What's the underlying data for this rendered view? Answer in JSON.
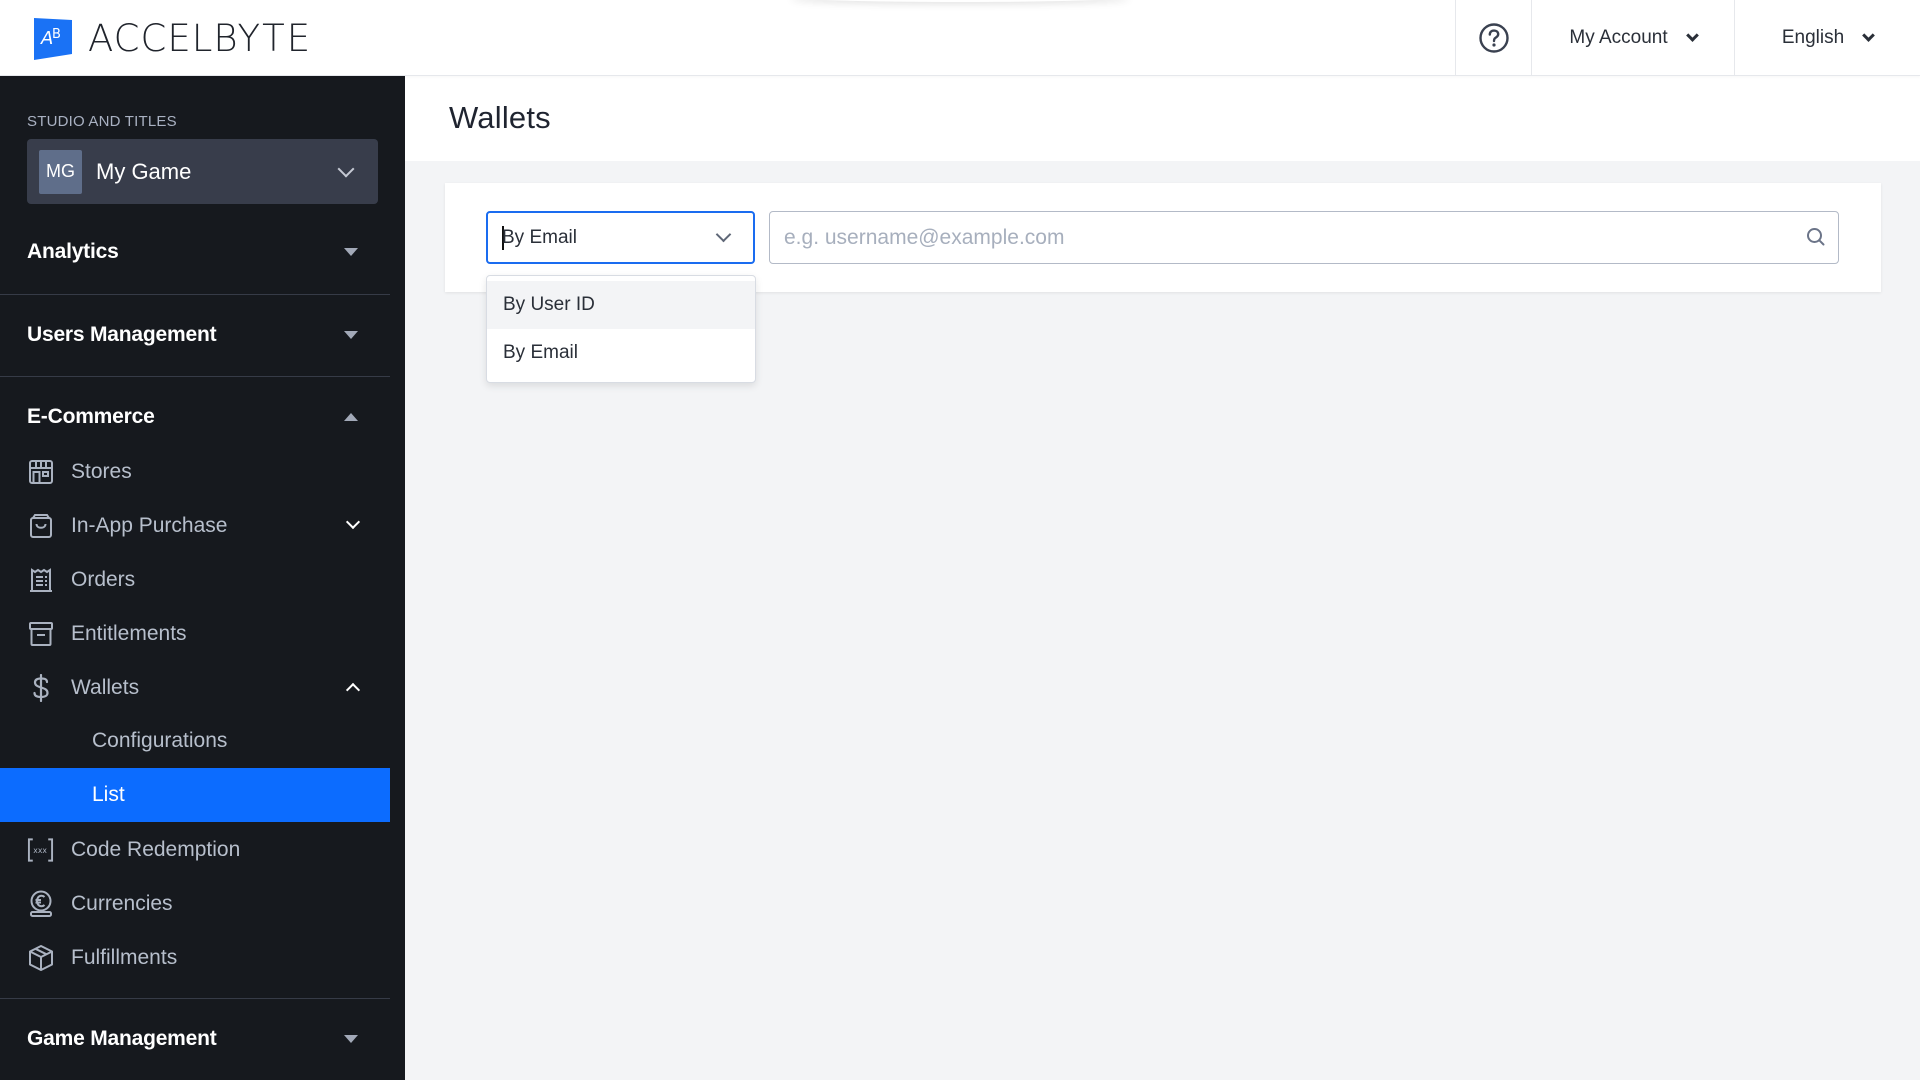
{
  "app": {
    "brand": "ACCELBYTE",
    "brand_part1": "ACCEL",
    "brand_part2": "BYTE",
    "logo_glyph": "AB"
  },
  "header": {
    "help_icon": "question-circle-icon",
    "account_label": "My Account",
    "language_label": "English"
  },
  "sidebar": {
    "studio_label": "STUDIO AND TITLES",
    "title_selector": {
      "initials": "MG",
      "name": "My Game"
    },
    "sections": {
      "analytics": "Analytics",
      "users_management": "Users Management",
      "ecommerce": "E-Commerce",
      "game_management": "Game Management"
    },
    "ecommerce_items": {
      "stores": "Stores",
      "in_app_purchase": "In-App Purchase",
      "orders": "Orders",
      "entitlements": "Entitlements",
      "wallets": "Wallets",
      "wallets_configurations": "Configurations",
      "wallets_list": "List",
      "code_redemption": "Code Redemption",
      "currencies": "Currencies",
      "fulfillments": "Fulfillments"
    },
    "active_item": "List"
  },
  "main": {
    "page_title": "Wallets",
    "search": {
      "filter_value": "By Email",
      "placeholder": "e.g. username@example.com",
      "value": ""
    },
    "filter_options": [
      {
        "label": "By User ID",
        "highlighted": true
      },
      {
        "label": "By Email",
        "highlighted": false
      }
    ]
  },
  "colors": {
    "accent": "#0c6cff",
    "sidebar_bg": "#16191e",
    "page_bg": "#f3f4f6"
  }
}
